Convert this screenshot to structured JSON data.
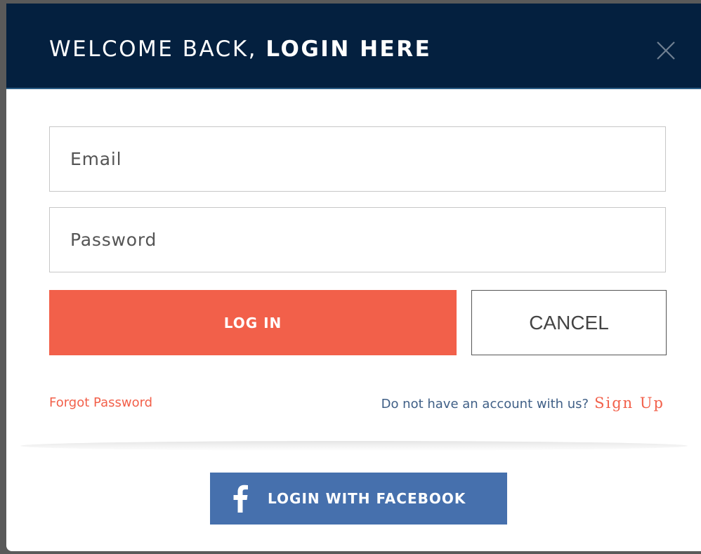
{
  "header": {
    "title_part1": "WELCOME BACK, ",
    "title_part2": "LOGIN HERE"
  },
  "close_icon": "close-icon",
  "form": {
    "email_placeholder": "Email",
    "password_placeholder": "Password",
    "login_label": "LOG IN",
    "cancel_label": "CANCEL"
  },
  "links": {
    "forgot_password": "Forgot Password",
    "no_account_text": "Do not have an account with us?",
    "sign_up": "Sign Up"
  },
  "facebook": {
    "label": "LOGIN WITH FACEBOOK",
    "icon": "facebook-icon"
  },
  "colors": {
    "header_bg": "#04203f",
    "accent": "#f2604a",
    "facebook": "#4670ad",
    "link_blue": "#3f5f86"
  }
}
